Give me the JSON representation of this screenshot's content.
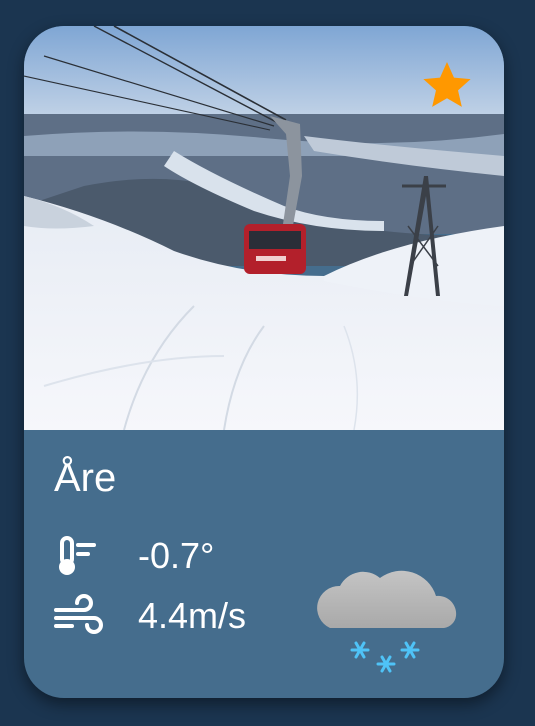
{
  "card": {
    "location": "Åre",
    "temperature": "-0.7°",
    "wind_speed": "4.4m/s",
    "favorite": true,
    "favorite_color": "#ff9800",
    "weather_icon": "snow-cloud-icon",
    "temperature_icon": "thermometer-icon",
    "wind_icon": "wind-icon",
    "photo_description": "ski-slope-cable-car-photo"
  }
}
